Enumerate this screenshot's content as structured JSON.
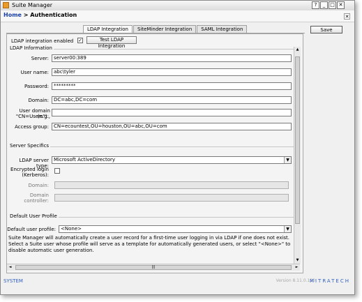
{
  "window": {
    "title": "Suite Manager"
  },
  "breadcrumb": {
    "home": "Home",
    "separator": " > ",
    "current": "Authentication"
  },
  "toolbar": {
    "save_label": "Save"
  },
  "tabs": [
    {
      "label": "LDAP Integration",
      "active": true
    },
    {
      "label": "SiteMinder Integration",
      "active": false
    },
    {
      "label": "SAML Integration",
      "active": false
    }
  ],
  "ldap": {
    "enabled_label": "LDAP integration enabled",
    "enabled_checked": true,
    "enabled_mark": "✓",
    "test_button": "Test LDAP Integration",
    "info_legend": "LDAP Information",
    "fields": {
      "server": {
        "label": "Server:",
        "value": "server00:389"
      },
      "username": {
        "label": "User name:",
        "value": "abc\\tyler"
      },
      "password": {
        "label": "Password:",
        "value": "*********"
      },
      "domain": {
        "label": "Domain:",
        "value": "DC=abc,DC=com"
      },
      "user_domain": {
        "label1": "User domain (e.g.,",
        "label2": "\"CN=Users\"):",
        "value": ""
      },
      "access_group": {
        "label": "Access group:",
        "value": "CN=ecountest,OU=houston,OU=abc,OU=com"
      }
    }
  },
  "server_specifics": {
    "legend": "Server Specifics",
    "server_type_label": "LDAP server type:",
    "server_type_value": "Microsoft ActiveDirectory",
    "encrypted_label1": "Encrypted login",
    "encrypted_label2": "(Kerberos):",
    "encrypted_checked": false,
    "domain_label": "Domain:",
    "domain_value": "",
    "controller_label1": "Domain",
    "controller_label2": "controller:",
    "controller_value": ""
  },
  "default_profile": {
    "legend": "Default User Profile",
    "label": "Default user profile:",
    "value": "<None>",
    "description": "Suite Manager will automatically create a user record for a first-time user logging in via LDAP if one does not exist. Select a Suite user whose profile will serve as a template for automatically generated users, or select \"<None>\" to disable automatic user generation."
  },
  "status": {
    "left": "SYSTEM",
    "version": "Version 8.11.0.120",
    "brand": "MITRATECH"
  },
  "icons": {
    "minimize": "_",
    "maximize": "□",
    "close": "✕",
    "help": "?",
    "dropdown": "▼",
    "scroll_up": "▲",
    "scroll_down": "▼",
    "scroll_left": "◄",
    "scroll_right": "►",
    "grip": "|||"
  },
  "colors": {
    "link": "#1a3faa",
    "status_blue": "#3060c0",
    "app_icon": "#e89a2a"
  }
}
